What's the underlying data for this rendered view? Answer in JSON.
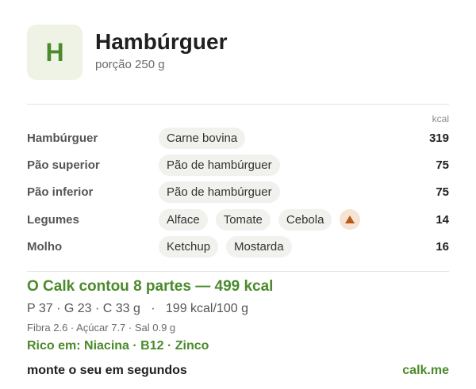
{
  "header": {
    "avatar_letter": "H",
    "title": "Hambúrguer",
    "subtitle": "porção 250 g"
  },
  "table": {
    "kcal_header": "kcal",
    "rows": [
      {
        "label": "Hambúrguer",
        "items": [
          "Carne bovina"
        ],
        "kcal": "319"
      },
      {
        "label": "Pão superior",
        "items": [
          "Pão de hambúrguer"
        ],
        "kcal": "75"
      },
      {
        "label": "Pão inferior",
        "items": [
          "Pão de hambúrguer"
        ],
        "kcal": "75"
      },
      {
        "label": "Legumes",
        "items": [
          "Alface",
          "Tomate",
          "Cebola"
        ],
        "kcal": "14",
        "warning_icon": "warning-triangle-icon"
      },
      {
        "label": "Molho",
        "items": [
          "Ketchup",
          "Mostarda"
        ],
        "kcal": "16"
      }
    ]
  },
  "summary": {
    "total": "O Calk contou 8 partes — 499 kcal",
    "macros": "P 37 · G 23 · C 33 g   ·   199 kcal/100 g",
    "minor": "Fibra 2.6 · Açúcar 7.7 · Sal 0.9 g",
    "rich": "Rico em: Niacina · B12 · Zinco"
  },
  "footer": {
    "cta": "monte o seu em segundos",
    "brand": "calk.me"
  },
  "colors": {
    "accent_green": "#4a8a2a",
    "avatar_bg": "#eef3e6",
    "chip_bg": "#f1f1ee",
    "warning": "#b65a1a"
  }
}
